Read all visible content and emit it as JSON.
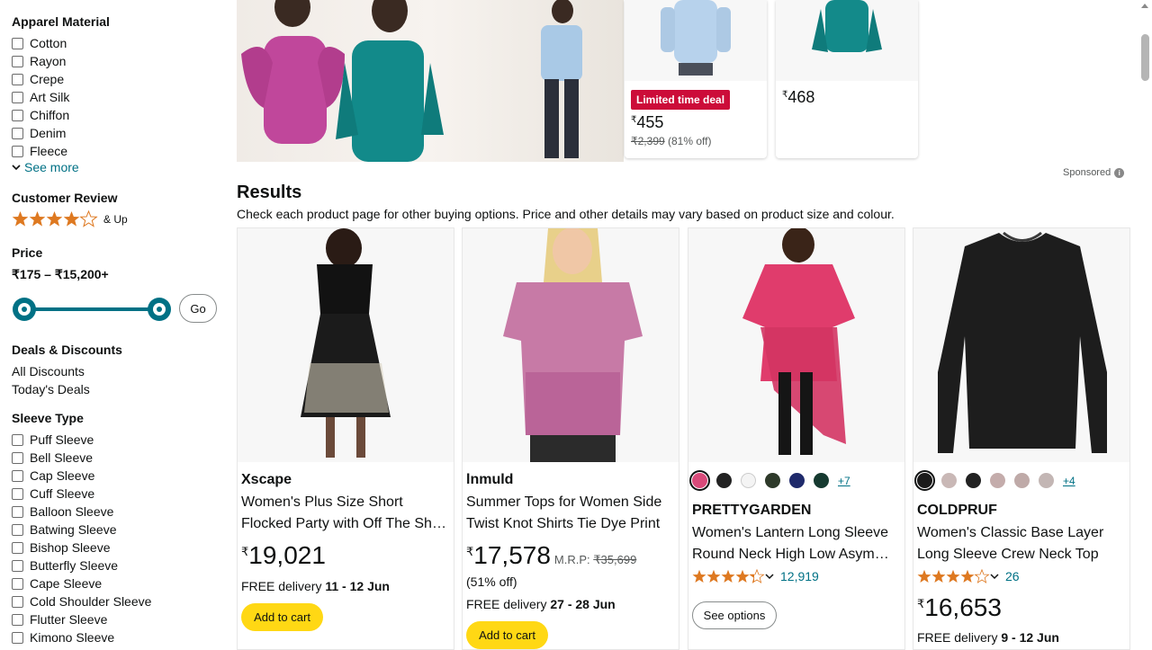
{
  "filters": {
    "apparel_material": {
      "title": "Apparel Material",
      "options": [
        "Cotton",
        "Rayon",
        "Crepe",
        "Art Silk",
        "Chiffon",
        "Denim",
        "Fleece"
      ],
      "see_more": "See more"
    },
    "customer_review": {
      "title": "Customer Review",
      "rating": 4,
      "suffix": "& Up"
    },
    "price": {
      "title": "Price",
      "range": "₹175 – ₹15,200+",
      "go": "Go"
    },
    "deals": {
      "title": "Deals & Discounts",
      "links": [
        "All Discounts",
        "Today's Deals"
      ]
    },
    "sleeve_type": {
      "title": "Sleeve Type",
      "options": [
        "Puff Sleeve",
        "Bell Sleeve",
        "Cap Sleeve",
        "Cuff Sleeve",
        "Balloon Sleeve",
        "Batwing Sleeve",
        "Bishop Sleeve",
        "Butterfly Sleeve",
        "Cape Sleeve",
        "Cold Shoulder Sleeve",
        "Flutter Sleeve",
        "Kimono Sleeve"
      ]
    }
  },
  "banner": {
    "deals": [
      {
        "badge": "Limited time deal",
        "currency": "₹",
        "price": "455",
        "old_price": "₹2,399",
        "discount": "(81% off)"
      },
      {
        "currency": "₹",
        "price": "468"
      }
    ],
    "sponsored": "Sponsored",
    "sponsored_info": "i"
  },
  "results": {
    "title": "Results",
    "subtitle": "Check each product page for other buying options. Price and other details may vary based on product size and colour."
  },
  "products": [
    {
      "brand": "Xscape",
      "title1": "Women's Plus Size Short",
      "title2": "Flocked Party with Off The Shoulder",
      "currency": "₹",
      "price": "19,021",
      "delivery_prefix": "FREE delivery ",
      "delivery_dates": "11 - 12 Jun",
      "button": "Add to cart"
    },
    {
      "brand": "lnmuld",
      "title1": "Summer Tops for Women Side",
      "title2": "Twist Knot Shirts Tie Dye Print",
      "currency": "₹",
      "price": "17,578",
      "mrp_label": "M.R.P: ",
      "mrp": "₹35,699",
      "discount": "(51% off)",
      "delivery_prefix": "FREE delivery ",
      "delivery_dates": "27 - 28 Jun",
      "button": "Add to cart"
    },
    {
      "brand": "PRETTYGARDEN",
      "title1": "Women's Lantern Long Sleeve",
      "title2": "Round Neck High Low Asymmetrical",
      "rating": 4.3,
      "reviews": "12,919",
      "more_colors": "+7",
      "swatches": [
        "#d94a7a",
        "#222222",
        "#f4f4f4",
        "#2e3a2a",
        "#1f2a6b",
        "#163a30"
      ],
      "button": "See options"
    },
    {
      "brand": "COLDPRUF",
      "title1": "Women's Classic Base Layer",
      "title2": "Long Sleeve Crew Neck Top",
      "rating": 4.1,
      "reviews": "26",
      "more_colors": "+4",
      "swatches": [
        "#1b1b1b",
        "#c9b8b6",
        "#222222",
        "#c4acab",
        "#bfaaa8",
        "#c3b6b4"
      ],
      "currency": "₹",
      "price": "16,653",
      "delivery_prefix": "FREE delivery ",
      "delivery_dates": "9 - 12 Jun"
    }
  ],
  "colors": {
    "link": "#007185",
    "star": "#de7921",
    "button_yellow": "#ffd814",
    "deal_red": "#cc0c39"
  }
}
